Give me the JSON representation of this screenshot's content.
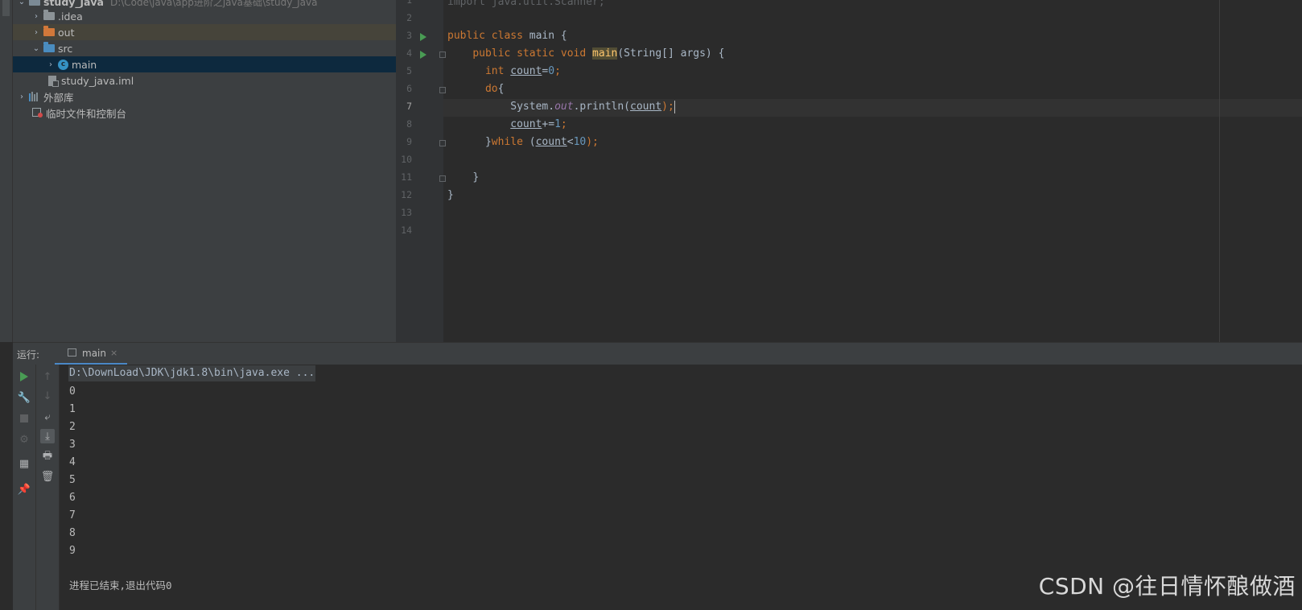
{
  "project_tree": {
    "root_name": "study_java",
    "root_path": "D:\\Code\\java\\app进阶之java基础\\study_java",
    "idea": ".idea",
    "out": "out",
    "src": "src",
    "main": "main",
    "iml": "study_java.iml",
    "external_libs": "外部库",
    "scratches": "临时文件和控制台"
  },
  "editor": {
    "line_numbers": [
      "1",
      "2",
      "3",
      "4",
      "5",
      "6",
      "7",
      "8",
      "9",
      "10",
      "11",
      "12",
      "13",
      "14"
    ],
    "line1": "import java.util.Scanner;",
    "line3": {
      "kw1": "public",
      "kw2": "class",
      "name": "main",
      "brace": "{"
    },
    "line4": {
      "kw1": "public",
      "kw2": "static",
      "kw3": "void",
      "method": "main",
      "params": "(String[] args) {"
    },
    "line5": {
      "kw": "int",
      "var": "count",
      "eq": "=",
      "num": "0",
      "semi": ";"
    },
    "line6": {
      "kw": "do",
      "brace": "{"
    },
    "line7": {
      "cls": "System.",
      "field": "out",
      "call": ".println(",
      "var": "count",
      "end": ");"
    },
    "line8": {
      "var": "count",
      "op": "+=",
      "num": "1",
      "semi": ";"
    },
    "line9": {
      "brace": "}",
      "kw": "while",
      "open": " (",
      "var": "count",
      "op": "<",
      "num": "10",
      "end": ");"
    },
    "line11": "}",
    "line12": "}"
  },
  "run_panel": {
    "label": "运行:",
    "tab_label": "main",
    "tab_close": "×",
    "command": "D:\\DownLoad\\JDK\\jdk1.8\\bin\\java.exe ...",
    "output": [
      "0",
      "1",
      "2",
      "3",
      "4",
      "5",
      "6",
      "7",
      "8",
      "9"
    ],
    "exit_message": "进程已结束,退出代码0"
  },
  "watermark": "CSDN @往日情怀酿做酒",
  "colors": {
    "keyword": "#cc7832",
    "number": "#6897bb",
    "field": "#9876aa",
    "method_highlight": "#ffc66d",
    "selection": "#0d293e",
    "run_green": "#499c54"
  }
}
